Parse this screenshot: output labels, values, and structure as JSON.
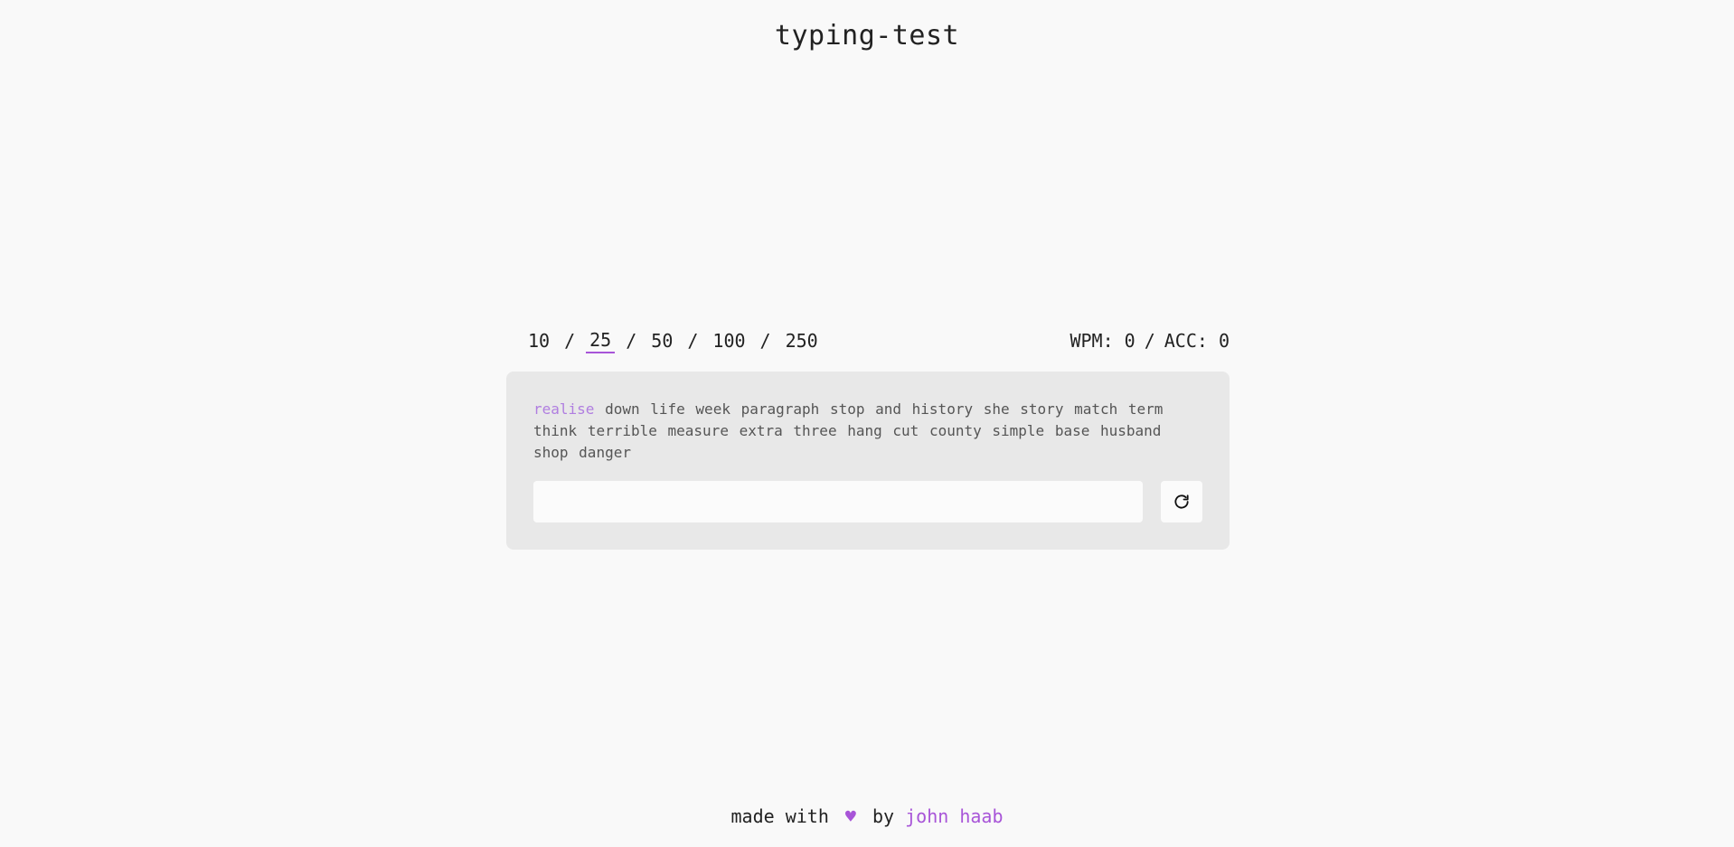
{
  "header": {
    "title": "typing-test"
  },
  "word_count": {
    "options": [
      "10",
      "25",
      "50",
      "100",
      "250"
    ],
    "selected": "25",
    "separator": "/"
  },
  "stats": {
    "wpm": "WPM: 0",
    "separator": "/",
    "acc": "ACC: 0"
  },
  "words": [
    "realise",
    "down",
    "life",
    "week",
    "paragraph",
    "stop",
    "and",
    "history",
    "she",
    "story",
    "match",
    "term",
    "think",
    "terrible",
    "measure",
    "extra",
    "three",
    "hang",
    "cut",
    "county",
    "simple",
    "base",
    "husband",
    "shop",
    "danger"
  ],
  "current_word_index": 0,
  "input": {
    "value": "",
    "placeholder": ""
  },
  "redo_button": {
    "icon": "redo-icon"
  },
  "footer": {
    "made_with": "made with",
    "heart": "♥",
    "by": "by",
    "author": "john haab"
  },
  "colors": {
    "accent": "#a855d8",
    "current_word": "#b07ee0",
    "background": "#f9f9f9",
    "card": "#e8e8e8"
  }
}
